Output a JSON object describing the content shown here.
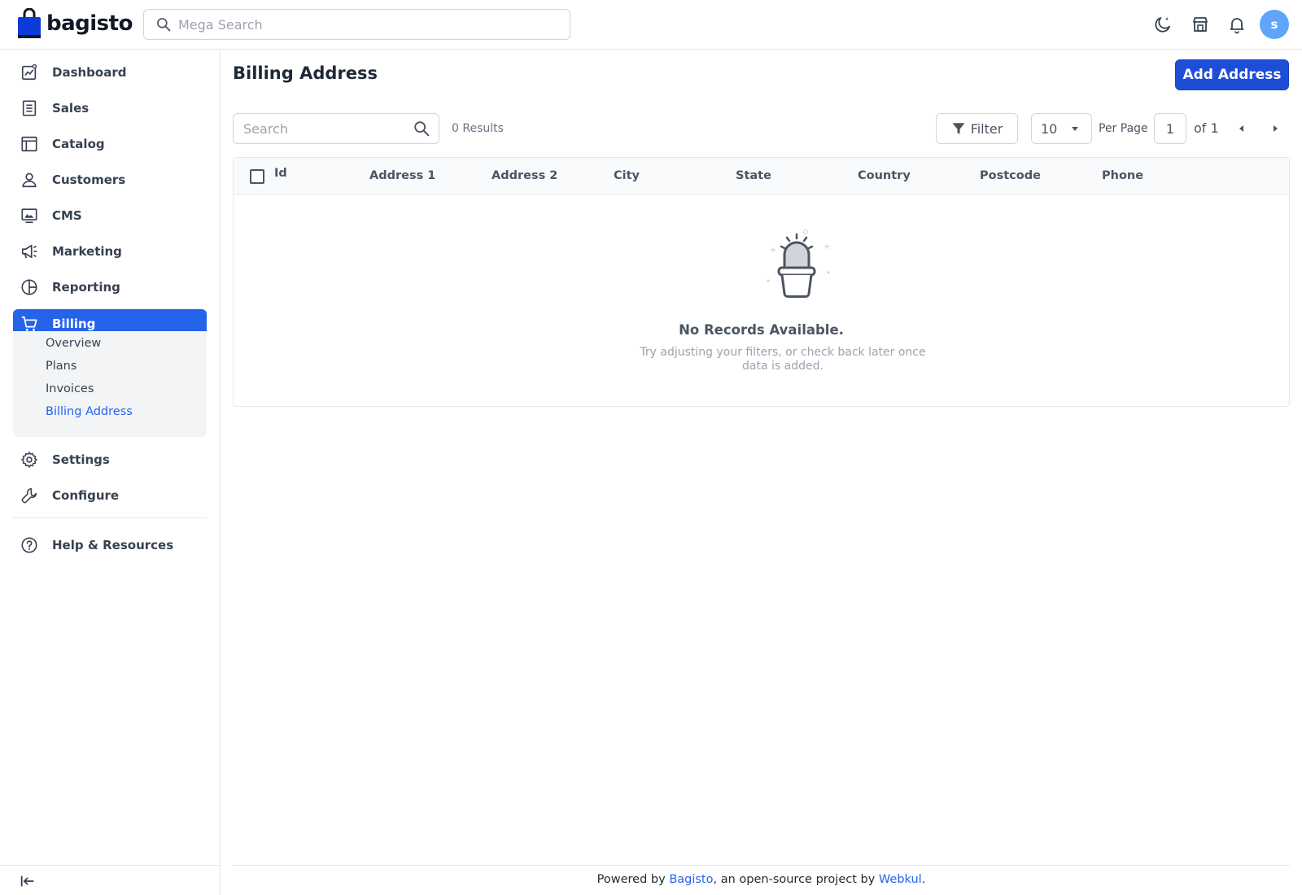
{
  "header": {
    "brand": "bagisto",
    "search_placeholder": "Mega Search",
    "avatar_initial": "s"
  },
  "sidebar": {
    "items": [
      {
        "label": "Dashboard",
        "icon": "dashboard-icon"
      },
      {
        "label": "Sales",
        "icon": "receipt-icon"
      },
      {
        "label": "Catalog",
        "icon": "catalog-icon"
      },
      {
        "label": "Customers",
        "icon": "user-icon"
      },
      {
        "label": "CMS",
        "icon": "monitor-icon"
      },
      {
        "label": "Marketing",
        "icon": "megaphone-icon"
      },
      {
        "label": "Reporting",
        "icon": "pie-chart-icon"
      },
      {
        "label": "Billing",
        "icon": "cart-icon",
        "active": true
      }
    ],
    "billing_submenu": [
      "Overview",
      "Plans",
      "Invoices",
      "Billing Address"
    ],
    "bottom_items": [
      {
        "label": "Settings",
        "icon": "gear-icon"
      },
      {
        "label": "Configure",
        "icon": "wrench-icon"
      }
    ],
    "help": {
      "label": "Help & Resources",
      "icon": "help-icon"
    }
  },
  "main": {
    "title": "Billing Address",
    "add_button": "Add Address"
  },
  "datagrid": {
    "search_placeholder": "Search",
    "results": "0 Results",
    "filter_label": "Filter",
    "per_page_value": "10",
    "per_page_label": "Per Page",
    "current_page": "1",
    "of_pages": "of 1",
    "columns": [
      "Id",
      "Address 1",
      "Address 2",
      "City",
      "State",
      "Country",
      "Postcode",
      "Phone"
    ],
    "rows": [],
    "empty_title": "No Records Available.",
    "empty_description": "Try adjusting your filters, or check back later once data is added."
  },
  "footer": {
    "prefix": "Powered by ",
    "bagisto_link": "Bagisto",
    "middle": ", an open-source project by ",
    "webkul_link": "Webkul",
    "suffix": "."
  },
  "colors": {
    "primary": "#2563eb",
    "primary_button": "#1d4ed8",
    "avatar": "#60a5fa"
  }
}
